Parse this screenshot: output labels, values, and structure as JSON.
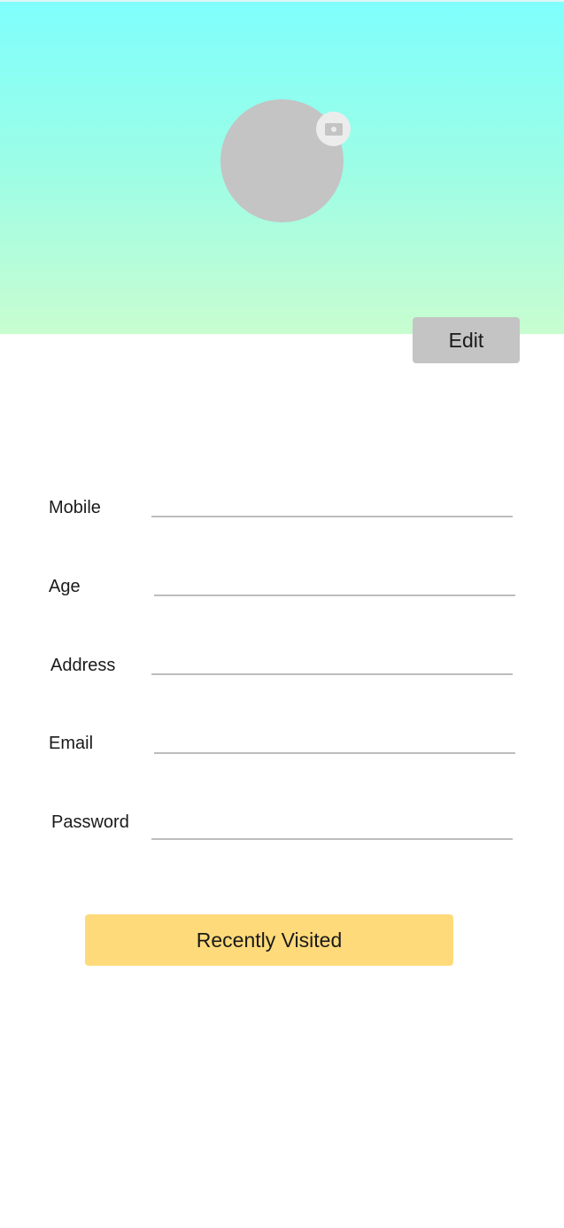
{
  "header": {
    "gradient_top": "#7ffffd",
    "gradient_bottom": "#c8fdd0",
    "avatar_color": "#c4c4c4",
    "camera_icon": "camera-icon"
  },
  "actions": {
    "edit_label": "Edit",
    "recent_label": "Recently Visited",
    "recent_color": "#ffda7a"
  },
  "form": {
    "mobile": {
      "label": "Mobile",
      "value": ""
    },
    "age": {
      "label": "Age",
      "value": ""
    },
    "address": {
      "label": "Address",
      "value": ""
    },
    "email": {
      "label": "Email",
      "value": ""
    },
    "password": {
      "label": "Password",
      "value": ""
    }
  }
}
